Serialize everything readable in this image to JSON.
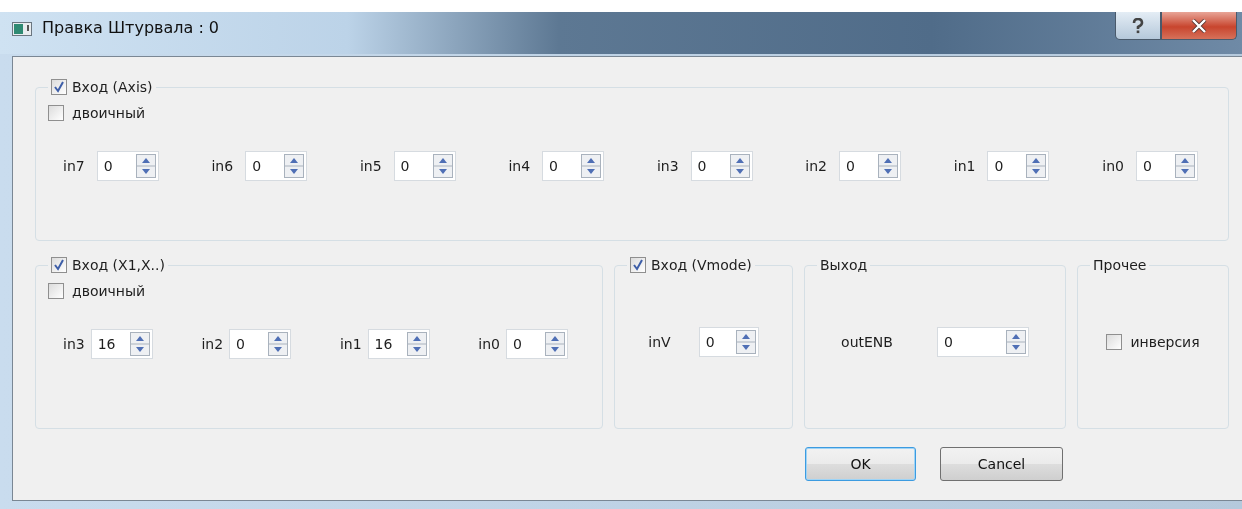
{
  "window": {
    "title": "Правка Штурвала : 0"
  },
  "axis_group": {
    "title": "Вход (Axis)",
    "checked": true,
    "binary": {
      "label": "двоичный",
      "checked": false
    },
    "inputs": [
      {
        "label": "in7",
        "value": "0"
      },
      {
        "label": "in6",
        "value": "0"
      },
      {
        "label": "in5",
        "value": "0"
      },
      {
        "label": "in4",
        "value": "0"
      },
      {
        "label": "in3",
        "value": "0"
      },
      {
        "label": "in2",
        "value": "0"
      },
      {
        "label": "in1",
        "value": "0"
      },
      {
        "label": "in0",
        "value": "0"
      }
    ]
  },
  "x_group": {
    "title": "Вход (X1,X..)",
    "checked": true,
    "binary": {
      "label": "двоичный",
      "checked": false
    },
    "inputs": [
      {
        "label": "in3",
        "value": "16"
      },
      {
        "label": "in2",
        "value": "0"
      },
      {
        "label": "in1",
        "value": "16"
      },
      {
        "label": "in0",
        "value": "0"
      }
    ]
  },
  "vmode_group": {
    "title": "Вход (Vmode)",
    "checked": true,
    "input": {
      "label": "inV",
      "value": "0"
    }
  },
  "output_group": {
    "title": "Выход",
    "input": {
      "label": "outENB",
      "value": "0"
    }
  },
  "other_group": {
    "title": "Прочее",
    "inversion": {
      "label": "инверсия",
      "checked": false
    }
  },
  "buttons": [
    {
      "label": "OK",
      "default": true
    },
    {
      "label": "Cancel",
      "default": false
    }
  ]
}
